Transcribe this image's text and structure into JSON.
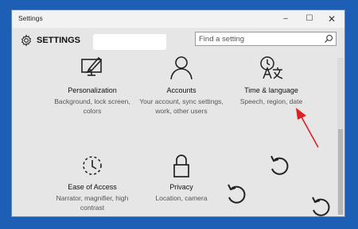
{
  "window": {
    "title": "Settings",
    "controls": {
      "minimize": "–",
      "maximize": "☐",
      "close": "✕"
    }
  },
  "header": {
    "title": "SETTINGS",
    "search_placeholder": "Find a setting"
  },
  "tiles": [
    {
      "title": "Personalization",
      "desc": "Background, lock screen, colors",
      "icon": "personalization-icon"
    },
    {
      "title": "Accounts",
      "desc": "Your account, sync settings, work, other users",
      "icon": "accounts-icon"
    },
    {
      "title": "Time & language",
      "desc": "Speech, region, date",
      "icon": "time-language-icon"
    },
    {
      "title": "Ease of Access",
      "desc": "Narrator, magnifier, high contrast",
      "icon": "ease-of-access-icon"
    },
    {
      "title": "Privacy",
      "desc": "Location, camera",
      "icon": "privacy-icon"
    }
  ],
  "colors": {
    "desktop": "#1c5fb4",
    "window_bg": "#e6e6e6",
    "annotation_arrow": "#e02020"
  }
}
